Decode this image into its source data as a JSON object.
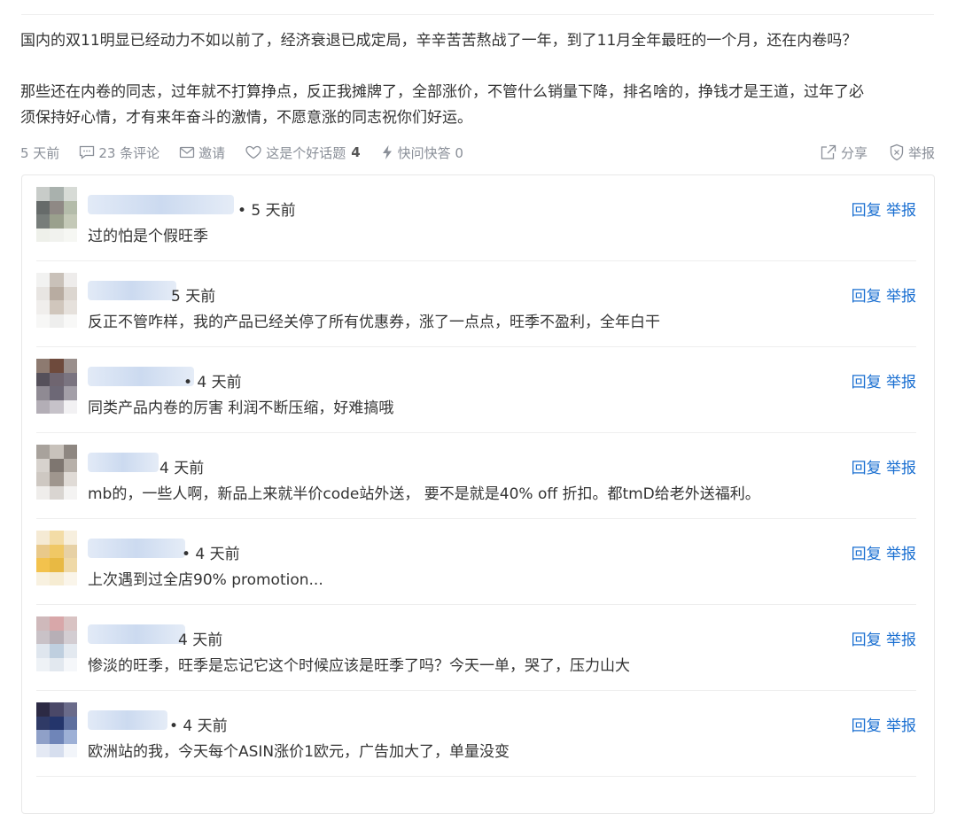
{
  "post": {
    "para1": "国内的双11明显已经动力不如以前了，经济衰退已成定局，辛辛苦苦熬战了一年，到了11月全年最旺的一个月，还在内卷吗？",
    "para2_line1": "那些还在内卷的同志，过年就不打算挣点，反正我摊牌了，全部涨价，不管什么销量下降，排名啥的，挣钱才是王道，过年了必",
    "para2_line2": "须保持好心情，才有来年奋斗的激情，不愿意涨的同志祝你们好运。"
  },
  "meta": {
    "time": "5 天前",
    "comments": "23 条评论",
    "invite": "邀请",
    "good_topic": "这是个好话题",
    "good_topic_count": "4",
    "quick_answer": "快问快答 0",
    "share": "分享",
    "report": "举报"
  },
  "icons": {
    "comment": "comment-bubble-icon",
    "invite": "mail-icon",
    "like": "heart-icon",
    "quick": "lightning-icon",
    "share": "share-arrow-icon",
    "report": "shield-report-icon"
  },
  "comments": [
    {
      "time": "• 5 天前",
      "text": "过的怕是个假旺季",
      "reply": "回复",
      "report": "举报"
    },
    {
      "time": "5 天前",
      "text": "反正不管咋样，我的产品已经关停了所有优惠券，涨了一点点，旺季不盈利，全年白干",
      "reply": "回复",
      "report": "举报"
    },
    {
      "time": "• 4 天前",
      "text": "同类产品内卷的厉害 利润不断压缩，好难搞哦",
      "reply": "回复",
      "report": "举报"
    },
    {
      "time": "4 天前",
      "text": "mb的，一些人啊，新品上来就半价code站外送， 要不是就是40% off 折扣。都tmD给老外送福利。",
      "reply": "回复",
      "report": "举报"
    },
    {
      "time": "• 4 天前",
      "text": "上次遇到过全店90% promotion...",
      "reply": "回复",
      "report": "举报"
    },
    {
      "time": "4 天前",
      "text": "惨淡的旺季，旺季是忘记它这个时候应该是旺季了吗？今天一单，哭了，压力山大",
      "reply": "回复",
      "report": "举报"
    },
    {
      "time": "• 4 天前",
      "text": "欧洲站的我，今天每个ASIN涨价1欧元，广告加大了，单量没变",
      "reply": "回复",
      "report": "举报"
    }
  ],
  "colors": {
    "link_blue": "#1a6fd1",
    "meta_gray": "#8a8f98",
    "text": "#333333"
  }
}
